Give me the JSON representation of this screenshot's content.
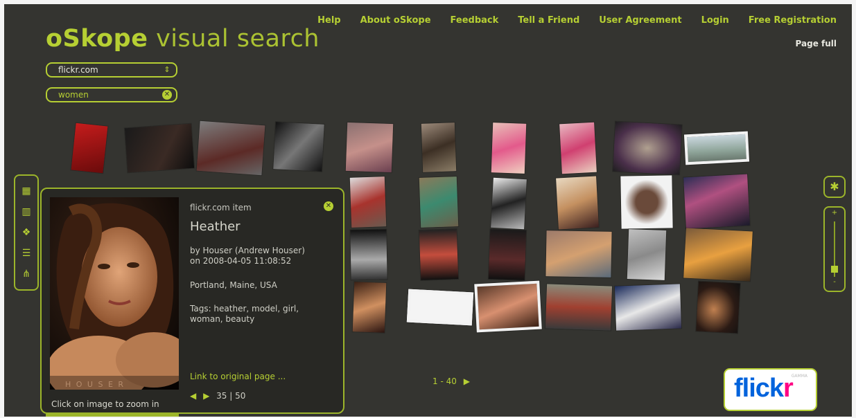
{
  "app": {
    "logo_bold": "oSkope",
    "logo_light": "visual search"
  },
  "topnav": [
    "Help",
    "About oSkope",
    "Feedback",
    "Tell a Friend",
    "User Agreement",
    "Login",
    "Free Registration"
  ],
  "page_full": "Page full",
  "source_select": {
    "value": "flickr.com"
  },
  "search": {
    "value": "women"
  },
  "left_tools": [
    "grid-view-icon",
    "stack-view-icon",
    "cluster-view-icon",
    "list-view-icon",
    "graph-view-icon"
  ],
  "pager": {
    "label": "1 - 40"
  },
  "detail": {
    "item_label": "flickr.com item",
    "title": "Heather",
    "author": "by Houser (Andrew Houser)",
    "date": "on 2008-04-05 11:08:52",
    "location": "Portland, Maine, USA",
    "tags": "Tags: heather, model, girl, woman, beauty",
    "link": "Link to original page ...",
    "counter": "35 | 50",
    "zoom_hint": "Click on image to zoom in",
    "watermark": "H O U S E R"
  },
  "brand": {
    "text1": "flick",
    "text2": "r",
    "gamma": "GAMMA"
  },
  "colors": {
    "accent": "#b6cf33",
    "background": "#343430",
    "flickr_blue": "#0063dc",
    "flickr_pink": "#ff0084"
  }
}
